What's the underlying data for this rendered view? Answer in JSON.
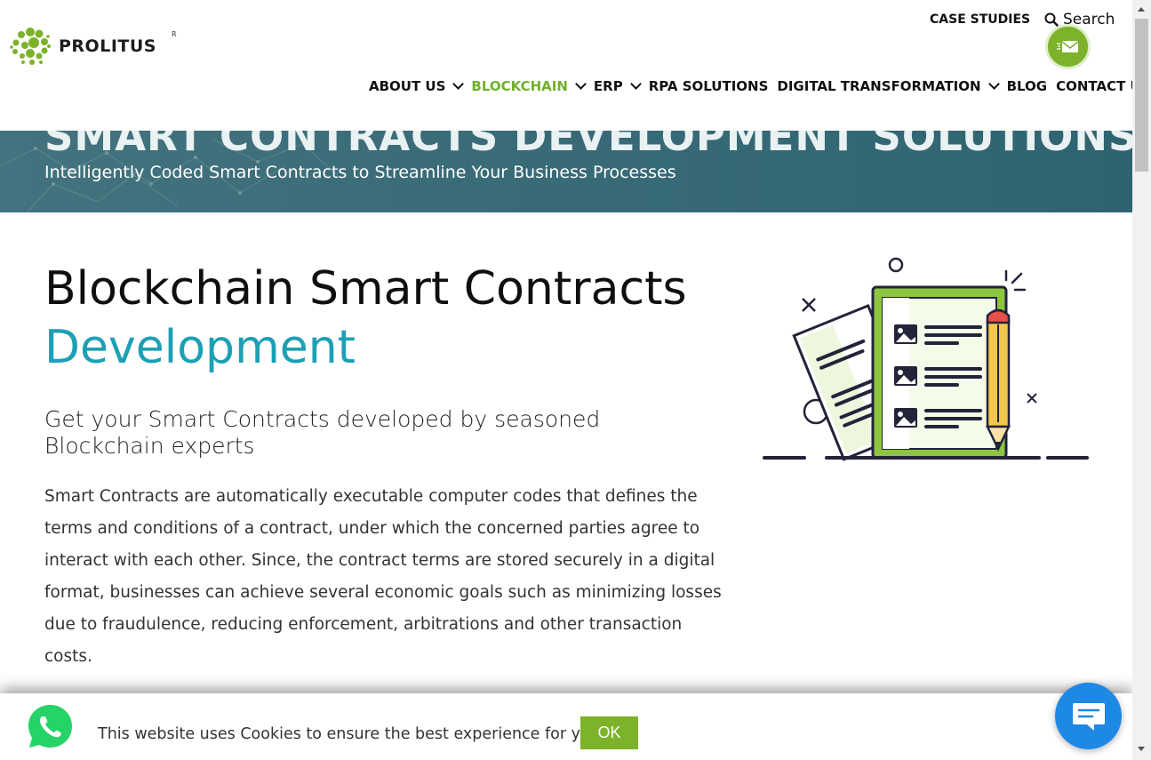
{
  "header": {
    "logo_text": "PROLITUS",
    "logo_reg": "R",
    "case_studies": "CASE STUDIES",
    "search_label": "Search",
    "nav": [
      {
        "label": "ABOUT US",
        "dropdown": true,
        "active": false
      },
      {
        "label": "BLOCKCHAIN",
        "dropdown": true,
        "active": true
      },
      {
        "label": "ERP",
        "dropdown": true,
        "active": false
      },
      {
        "label": "RPA SOLUTIONS",
        "dropdown": false,
        "active": false
      },
      {
        "label": "DIGITAL TRANSFORMATION",
        "dropdown": true,
        "active": false
      },
      {
        "label": "BLOG",
        "dropdown": false,
        "active": false
      },
      {
        "label": "CONTACT US",
        "dropdown": false,
        "active": false
      }
    ]
  },
  "banner": {
    "title": "SMART CONTRACTS DEVELOPMENT SOLUTIONS",
    "subtitle": "Intelligently Coded Smart Contracts to Streamline Your Business Processes"
  },
  "main": {
    "heading_line1": "Blockchain Smart Contracts",
    "heading_line2": "Development",
    "subheading": "Get your Smart Contracts developed by seasoned Blockchain experts",
    "paragraph": "Smart Contracts are automatically executable computer codes that defines the terms and conditions of a contract, under which the concerned parties agree to interact with each other. Since, the contract terms are stored securely in a digital format, businesses can achieve several economic goals such as minimizing losses due to fraudulence, reducing enforcement, arbitrations and other transaction costs."
  },
  "cookie": {
    "text": "This website uses Cookies to ensure the best experience for you.",
    "ok_label": "OK"
  },
  "icons": {
    "search": "search-icon",
    "mail": "mail-icon",
    "whatsapp": "whatsapp-icon",
    "chat": "chat-icon",
    "dropdown": "chevron-down-icon"
  },
  "colors": {
    "brand_green": "#7cb32a",
    "nav_active": "#6fb22c",
    "accent_teal": "#1ba0b5",
    "banner_bg": "#3a6c78",
    "chat_blue": "#1e88e5"
  }
}
